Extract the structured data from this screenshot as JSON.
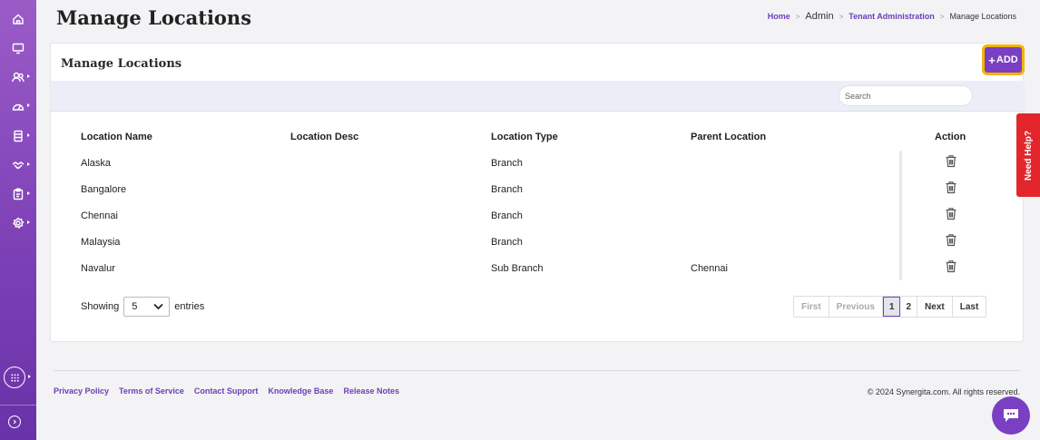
{
  "page": {
    "title": "Manage Locations"
  },
  "breadcrumb": {
    "home": "Home",
    "admin": "Admin",
    "tenant": "Tenant Administration",
    "current": "Manage Locations",
    "separator": ">"
  },
  "card": {
    "title": "Manage Locations"
  },
  "toolbar": {
    "search_placeholder": "Search",
    "add_label": "ADD",
    "add_plus": "+"
  },
  "table": {
    "headers": [
      "Location Name",
      "Location Desc",
      "Location Type",
      "Parent Location",
      "Action"
    ],
    "rows": [
      {
        "name": "Alaska",
        "desc": "",
        "type": "Branch",
        "parent": ""
      },
      {
        "name": "Bangalore",
        "desc": "",
        "type": "Branch",
        "parent": ""
      },
      {
        "name": "Chennai",
        "desc": "",
        "type": "Branch",
        "parent": ""
      },
      {
        "name": "Malaysia",
        "desc": "",
        "type": "Branch",
        "parent": ""
      },
      {
        "name": "Navalur",
        "desc": "",
        "type": "Sub Branch",
        "parent": "Chennai"
      }
    ]
  },
  "pagination": {
    "showing_label": "Showing",
    "entries_value": "5",
    "entries_label": "entries",
    "first": "First",
    "previous": "Previous",
    "page1": "1",
    "page2": "2",
    "next": "Next",
    "last": "Last"
  },
  "help": {
    "label": "Need Help?"
  },
  "footer": {
    "links": [
      "Privacy Policy",
      "Terms of Service",
      "Contact Support",
      "Knowledge Base",
      "Release Notes"
    ],
    "copyright": "© 2024 Synergita.com. All rights reserved."
  },
  "colors": {
    "accent": "#7a3fc2",
    "highlight": "#f4b400",
    "help": "#e2262b",
    "link": "#6a3fb5"
  },
  "icons": {
    "sidebar": [
      "home-icon",
      "monitor-icon",
      "users-icon",
      "gauge-icon",
      "database-icon",
      "handshake-icon",
      "clipboard-icon",
      "settings-icon"
    ],
    "action": "trash-icon",
    "apps": "apps-grid-icon",
    "chat": "chat-icon"
  }
}
